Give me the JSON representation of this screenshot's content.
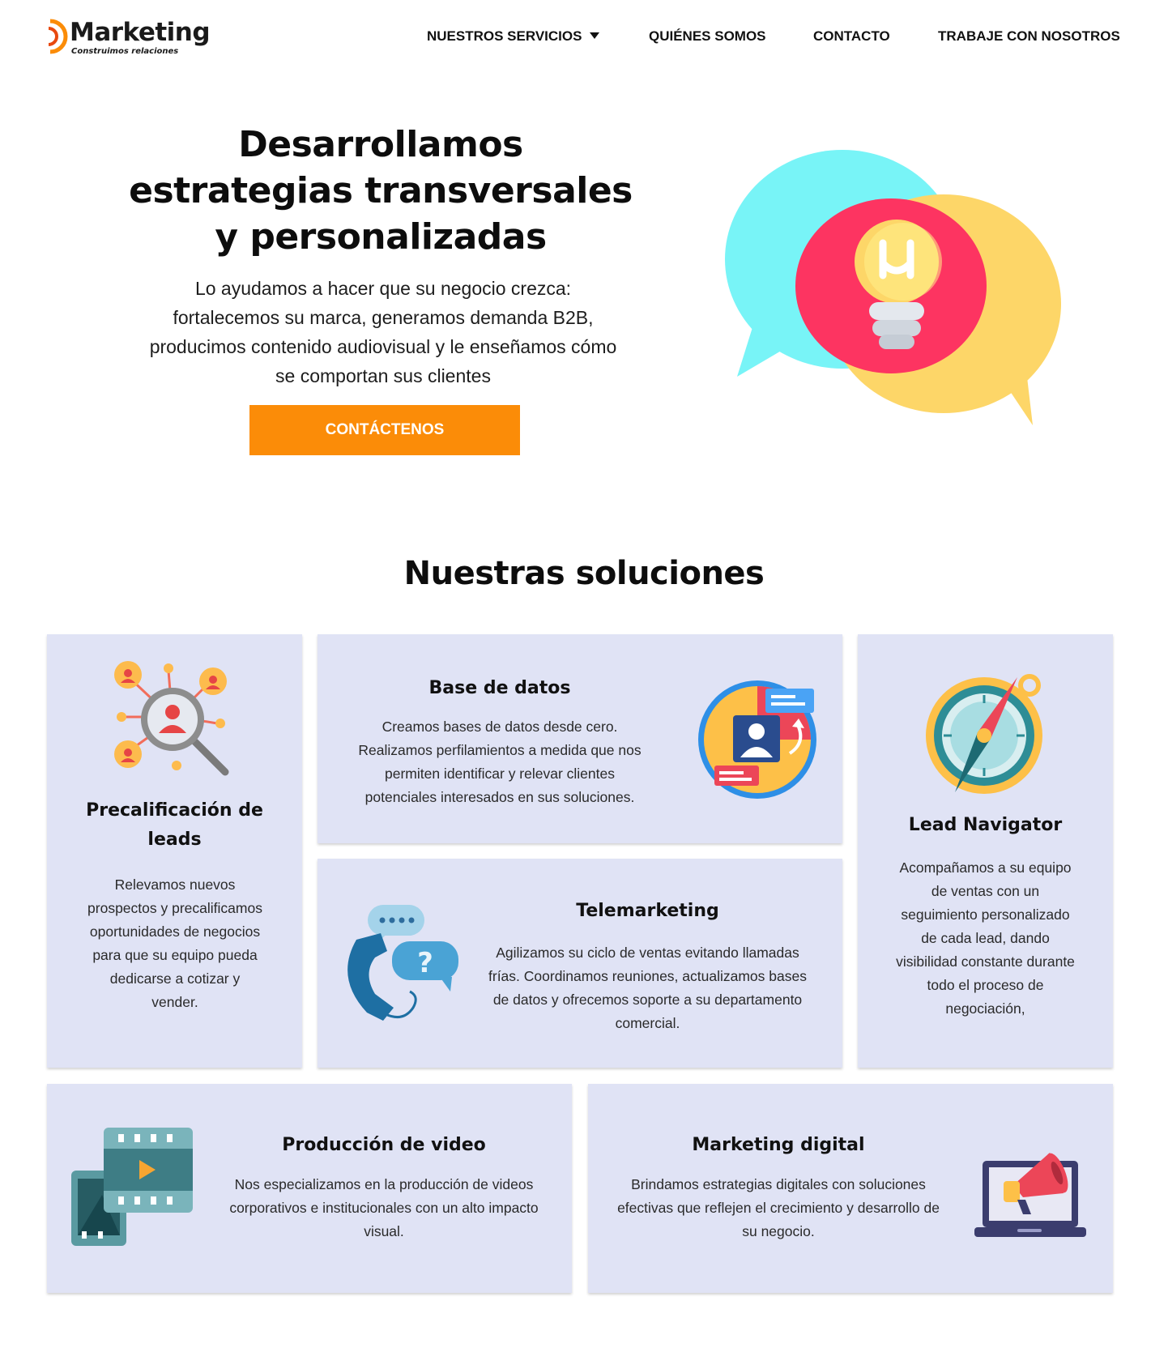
{
  "brand": {
    "name": "Marketing",
    "tagline": "Construimos relaciones",
    "accent_color": "#fb8c08",
    "logo_icon": "target-arc-icon"
  },
  "nav": {
    "items": [
      {
        "label": "NUESTROS SERVICIOS",
        "has_dropdown": true
      },
      {
        "label": "QUIÉNES SOMOS"
      },
      {
        "label": "CONTACTO"
      },
      {
        "label": "TRABAJE CON NOSOTROS"
      }
    ]
  },
  "hero": {
    "title": "Desarrollamos estrategias transversales y personalizadas",
    "subtitle": "Lo ayudamos a hacer que su negocio crezca: fortalecemos su marca, generamos demanda B2B, producimos contenido audiovisual y le enseñamos cómo se comportan sus clientes",
    "cta_label": "CONTÁCTENOS",
    "illustration_icon": "speech-bubbles-lightbulb-icon"
  },
  "solutions": {
    "title": "Nuestras soluciones",
    "card_color": "#e0e3f5",
    "cards": [
      {
        "id": "leads",
        "title": "Precalificación de leads",
        "text": "Relevamos nuevos prospectos y precalificamos oportunidades de negocios para que su equipo pueda dedicarse a cotizar y vender.",
        "icon": "magnifier-people-icon"
      },
      {
        "id": "database",
        "title": "Base de datos",
        "text": "Creamos bases de datos desde cero. Realizamos perfilamientos a medida que nos permiten identificar y relevar clientes potenciales interesados en sus soluciones.",
        "icon": "database-profile-icon"
      },
      {
        "id": "navigator",
        "title": "Lead Navigator",
        "text": "Acompañamos a su equipo de ventas con un seguimiento personalizado de cada lead, dando visibilidad constante durante todo el proceso de negociación,",
        "icon": "compass-icon"
      },
      {
        "id": "telemarketing",
        "title": "Telemarketing",
        "text": "Agilizamos su ciclo de ventas evitando llamadas frías. Coordinamos reuniones, actualizamos bases de datos y ofrecemos soporte a su departamento comercial.",
        "icon": "phone-chat-icon"
      },
      {
        "id": "video",
        "title": "Producción de video",
        "text": "Nos especializamos en la producción de videos corporativos e institucionales con un alto impacto visual.",
        "icon": "film-strip-icon"
      },
      {
        "id": "digital",
        "title": "Marketing digital",
        "text": "Brindamos estrategias digitales con soluciones efectivas que reflejen el crecimiento y desarrollo de su negocio.",
        "icon": "laptop-megaphone-icon"
      }
    ]
  }
}
